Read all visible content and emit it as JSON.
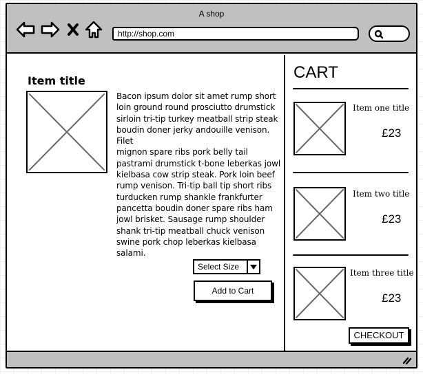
{
  "window": {
    "title": "A shop",
    "url": "http://shop.com"
  },
  "toolbar": {
    "icons": [
      "back-arrow-icon",
      "forward-arrow-icon",
      "stop-x-icon",
      "home-icon",
      "search-icon"
    ]
  },
  "product": {
    "title": "Item title",
    "description": "Bacon ipsum dolor sit amet rump short\nloin ground round prosciutto drumstick\nsirloin tri-tip turkey meatball strip steak\nboudin doner jerky andouille venison. Filet\nmignon spare ribs pork belly tail\npastrami drumstick t-bone leberkas jowl\nkielbasa cow strip steak. Pork loin beef\nrump venison. Tri-tip ball tip short ribs\nturducken rump shankle frankfurter\npancetta boudin doner spare ribs ham\njowl brisket. Sausage rump shoulder\nshank tri-tip meatball chuck venison\nswine pork chop leberkas kielbasa\nsalami.",
    "size_select": "Select Size",
    "add_to_cart": "Add to Cart"
  },
  "cart": {
    "title": "CART",
    "items": [
      {
        "title": "Item one title",
        "price": "£23"
      },
      {
        "title": "Item two title",
        "price": "£23"
      },
      {
        "title": "Item three title",
        "price": "£23"
      }
    ],
    "checkout": "CHECKOUT"
  }
}
